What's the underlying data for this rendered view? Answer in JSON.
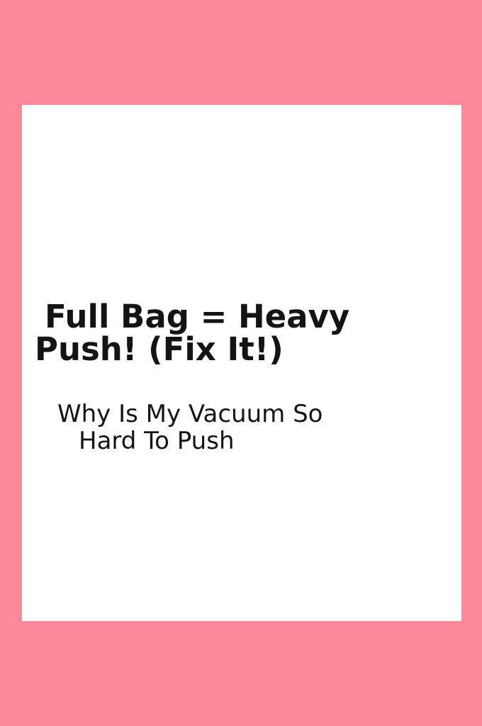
{
  "headline": {
    "line1": "Full Bag = Heavy",
    "line2": "Push! (Fix It!)"
  },
  "subtitle": {
    "line1": "Why Is My Vacuum So",
    "line2": "Hard To Push"
  },
  "colors": {
    "background": "#FC8899",
    "card": "#FFFFFF",
    "text": "#141414"
  }
}
